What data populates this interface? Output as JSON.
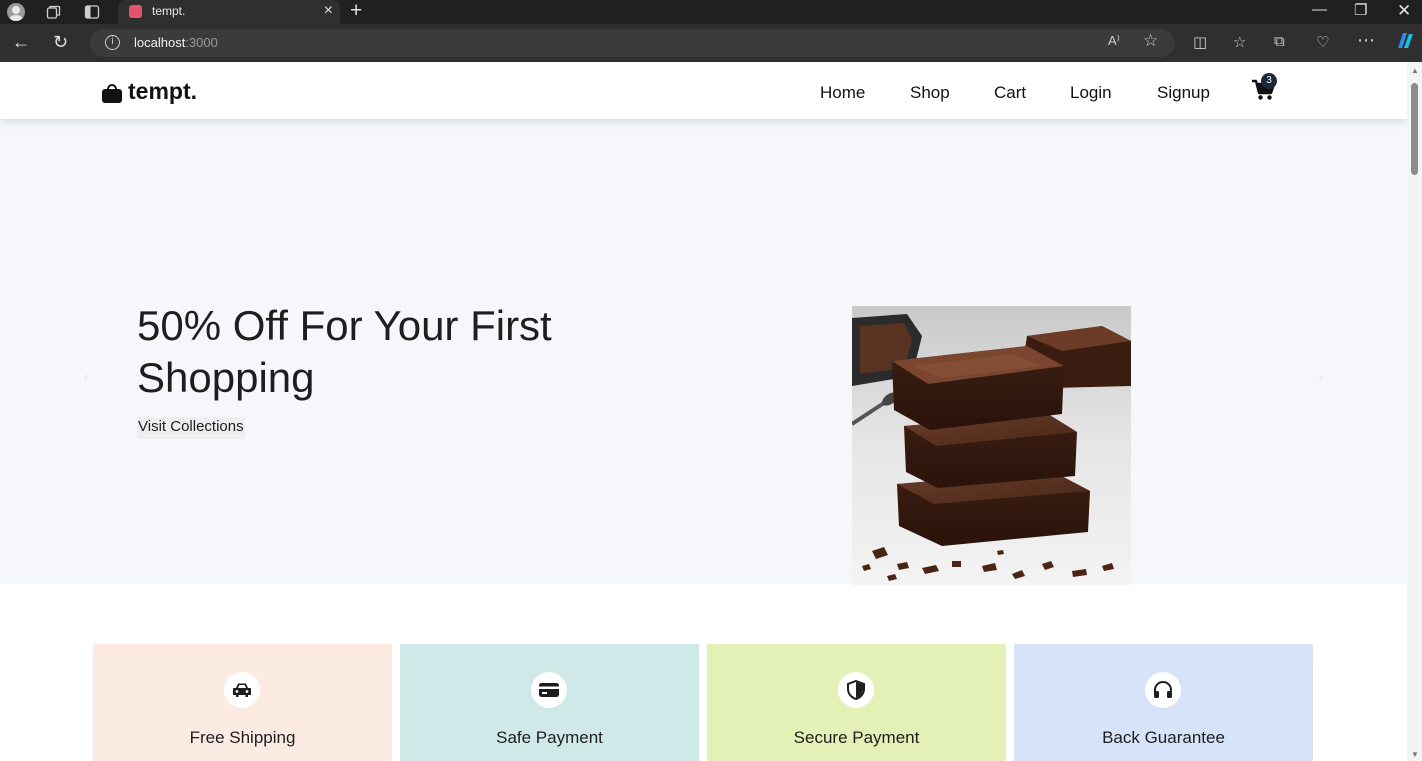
{
  "browser": {
    "tab_title": "tempt.",
    "url_host": "localhost",
    "url_port": ":3000"
  },
  "header": {
    "logo_text": "tempt.",
    "nav": [
      "Home",
      "Shop",
      "Cart",
      "Login",
      "Signup"
    ],
    "cart_count": "3"
  },
  "hero": {
    "title": "50% Off For Your First Shopping",
    "button_label": "Visit Collections"
  },
  "features": [
    {
      "label": "Free Shipping",
      "icon": "car-icon",
      "color": "#fcebe3"
    },
    {
      "label": "Safe Payment",
      "icon": "credit-card-icon",
      "color": "#cfe8e8"
    },
    {
      "label": "Secure Payment",
      "icon": "shield-icon",
      "color": "#e3f1b6"
    },
    {
      "label": "Back Guarantee",
      "icon": "headphones-icon",
      "color": "#d6e3f8"
    }
  ]
}
